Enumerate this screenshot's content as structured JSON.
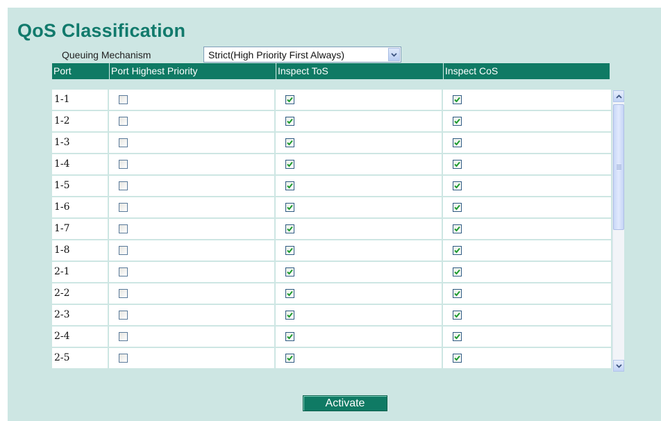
{
  "page": {
    "title": "QoS Classification"
  },
  "queuing": {
    "label": "Queuing Mechanism",
    "value": "Strict(High Priority First Always)"
  },
  "table": {
    "headers": [
      "Port",
      "Port Highest Priority",
      "Inspect ToS",
      "Inspect CoS"
    ],
    "rows": [
      {
        "port": "1-1",
        "highest": false,
        "tos": true,
        "cos": true
      },
      {
        "port": "1-2",
        "highest": false,
        "tos": true,
        "cos": true
      },
      {
        "port": "1-3",
        "highest": false,
        "tos": true,
        "cos": true
      },
      {
        "port": "1-4",
        "highest": false,
        "tos": true,
        "cos": true
      },
      {
        "port": "1-5",
        "highest": false,
        "tos": true,
        "cos": true
      },
      {
        "port": "1-6",
        "highest": false,
        "tos": true,
        "cos": true
      },
      {
        "port": "1-7",
        "highest": false,
        "tos": true,
        "cos": true
      },
      {
        "port": "1-8",
        "highest": false,
        "tos": true,
        "cos": true
      },
      {
        "port": "2-1",
        "highest": false,
        "tos": true,
        "cos": true
      },
      {
        "port": "2-2",
        "highest": false,
        "tos": true,
        "cos": true
      },
      {
        "port": "2-3",
        "highest": false,
        "tos": true,
        "cos": true
      },
      {
        "port": "2-4",
        "highest": false,
        "tos": true,
        "cos": true
      },
      {
        "port": "2-5",
        "highest": false,
        "tos": true,
        "cos": true
      }
    ]
  },
  "icons": {
    "dropdown": "chevron-down-icon",
    "scroll_up": "arrow-up-icon",
    "scroll_down": "arrow-down-icon"
  },
  "colors": {
    "accent": "#0f7a64",
    "title": "#117a6c",
    "panel": "#cde6e3"
  },
  "actions": {
    "activate_label": "Activate"
  }
}
